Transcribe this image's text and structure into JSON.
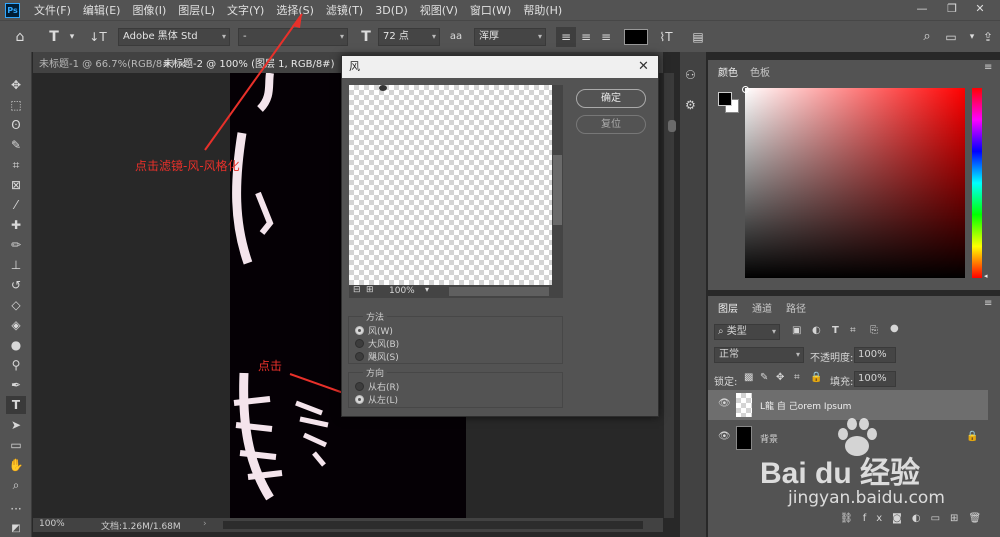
{
  "menubar": {
    "logo": "Ps",
    "items": [
      "文件(F)",
      "编辑(E)",
      "图像(I)",
      "图层(L)",
      "文字(Y)",
      "选择(S)",
      "滤镜(T)",
      "3D(D)",
      "视图(V)",
      "窗口(W)",
      "帮助(H)"
    ],
    "window_controls": [
      "—",
      "❐",
      "✕"
    ]
  },
  "options": {
    "font_family": "Adobe 黑体 Std",
    "font_style": "-",
    "font_size": "72 点",
    "aa_label": "aa",
    "antialias": "浑厚"
  },
  "tabs": [
    {
      "label": "未标题-1 @ 66.7%(RGB/8#)"
    },
    {
      "label": "未标题-2 @ 100% (图层 1, RGB/8#)"
    }
  ],
  "status": {
    "zoom": "100%",
    "doc": "文档:1.26M/1.68M"
  },
  "dialog": {
    "title": "风",
    "ok": "确定",
    "reset": "复位",
    "zoom": "100%",
    "method_title": "方法",
    "method_options": [
      "风(W)",
      "大风(B)",
      "飓风(S)"
    ],
    "method_selected": 0,
    "direction_title": "方向",
    "direction_options": [
      "从右(R)",
      "从左(L)"
    ],
    "direction_selected": 1
  },
  "color_panel": {
    "tabs": [
      "颜色",
      "色板"
    ]
  },
  "layers_panel": {
    "tabs": [
      "图层",
      "通道",
      "路径"
    ],
    "filter_kind": "类型",
    "blend_mode": "正常",
    "opacity_label": "不透明度:",
    "opacity": "100%",
    "lock_label": "锁定:",
    "fill_label": "填充:",
    "fill": "100%",
    "layers": [
      {
        "name": "L龍 自 己orem Ipsum",
        "selected": true
      },
      {
        "name": "背景",
        "selected": false
      }
    ]
  },
  "annotations": {
    "filter_hint": "点击滤镜-风-风格化",
    "click_hint": "点击"
  },
  "watermark": {
    "brand": "Bai du 经验",
    "url": "jingyan.baidu.com"
  },
  "colors": {
    "accent_red": "#e8302a",
    "ui_bg": "#535353",
    "dark_bg": "#282828"
  }
}
